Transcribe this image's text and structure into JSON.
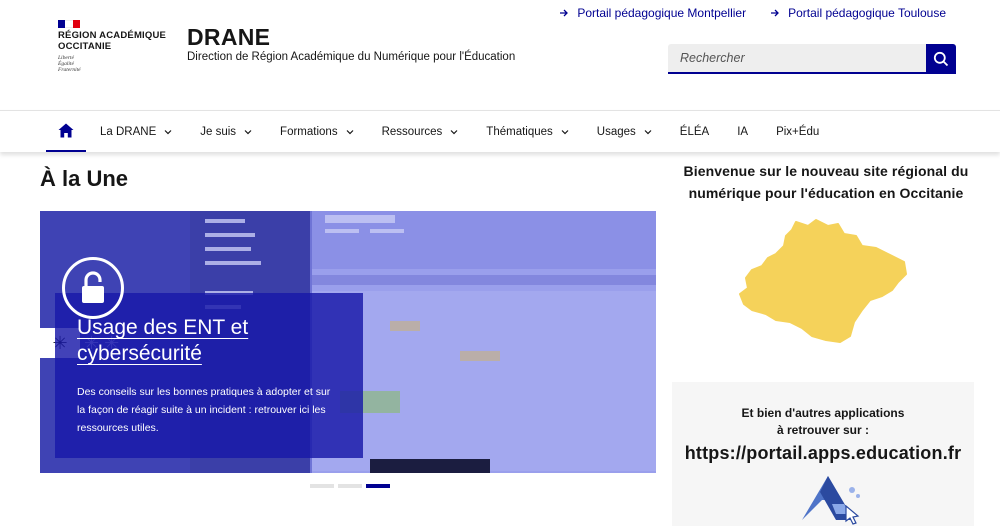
{
  "header": {
    "logo_line1": "RÉGION ACADÉMIQUE",
    "logo_line2": "OCCITANIE",
    "motto1": "Liberté",
    "motto2": "Égalité",
    "motto3": "Fraternité",
    "site_title": "DRANE",
    "site_subtitle": "Direction de Région Académique du Numérique pour l'Éducation",
    "quick_links": [
      {
        "label": "Portail pédagogique Montpellier",
        "icon": "arrow-right-icon"
      },
      {
        "label": "Portail pédagogique Toulouse",
        "icon": "arrow-right-icon"
      }
    ],
    "search": {
      "placeholder": "Rechercher",
      "icon": "search-icon"
    },
    "flag_colors": [
      "#000091",
      "#ffffff",
      "#e1000f"
    ]
  },
  "nav": {
    "home_icon": "home-icon",
    "items": [
      {
        "label": "La DRANE",
        "dropdown": true
      },
      {
        "label": "Je suis",
        "dropdown": true
      },
      {
        "label": "Formations",
        "dropdown": true
      },
      {
        "label": "Ressources",
        "dropdown": true
      },
      {
        "label": "Thématiques",
        "dropdown": true
      },
      {
        "label": "Usages",
        "dropdown": true
      },
      {
        "label": "ÉLÉA",
        "dropdown": false
      },
      {
        "label": "IA",
        "dropdown": false
      },
      {
        "label": "Pix+Édu",
        "dropdown": false
      }
    ]
  },
  "main": {
    "section_title": "À la Une",
    "slide": {
      "title_line1": "Usage des ENT et",
      "title_line2": "cybersécurité",
      "description": "Des conseils sur les bonnes pratiques à adopter et sur la façon de réagir suite à un incident : retrouver ici les ressources utiles.",
      "icon": "lock-icon"
    },
    "carousel_active_index": 3,
    "carousel_count": 3
  },
  "sidebar": {
    "welcome": "Bienvenue sur le nouveau site régional du numérique pour l'éducation en Occitanie",
    "map_color": "#f5d25a",
    "apps_line1": "Et bien d'autres applications",
    "apps_line2": "à retrouver sur :",
    "apps_url": "https://portail.apps.education.fr"
  },
  "colors": {
    "accent": "#000091",
    "card_bg": "#1818a8"
  }
}
